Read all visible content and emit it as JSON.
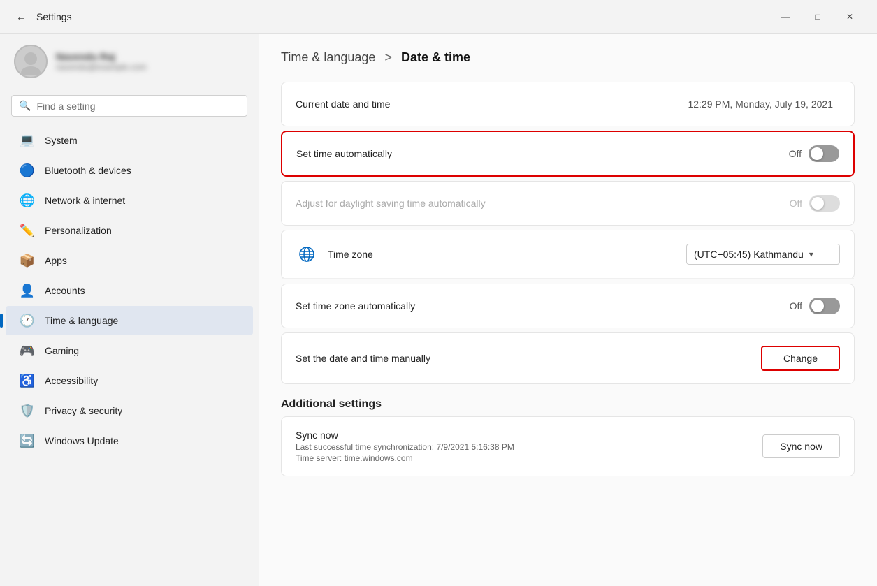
{
  "titlebar": {
    "title": "Settings",
    "back_icon": "←",
    "minimize_icon": "—",
    "maximize_icon": "□",
    "close_icon": "✕"
  },
  "user": {
    "name": "Navendu Raj",
    "email": "navendu@example.com"
  },
  "search": {
    "placeholder": "Find a setting"
  },
  "nav": {
    "items": [
      {
        "id": "system",
        "label": "System",
        "icon": "💻",
        "active": false
      },
      {
        "id": "bluetooth",
        "label": "Bluetooth & devices",
        "icon": "🔵",
        "active": false
      },
      {
        "id": "network",
        "label": "Network & internet",
        "icon": "🌐",
        "active": false
      },
      {
        "id": "personalization",
        "label": "Personalization",
        "icon": "✏️",
        "active": false
      },
      {
        "id": "apps",
        "label": "Apps",
        "icon": "📦",
        "active": false
      },
      {
        "id": "accounts",
        "label": "Accounts",
        "icon": "👤",
        "active": false
      },
      {
        "id": "time-language",
        "label": "Time & language",
        "icon": "🕐",
        "active": true
      },
      {
        "id": "gaming",
        "label": "Gaming",
        "icon": "🎮",
        "active": false
      },
      {
        "id": "accessibility",
        "label": "Accessibility",
        "icon": "♿",
        "active": false
      },
      {
        "id": "privacy-security",
        "label": "Privacy & security",
        "icon": "🛡️",
        "active": false
      },
      {
        "id": "windows-update",
        "label": "Windows Update",
        "icon": "🔄",
        "active": false
      }
    ]
  },
  "page": {
    "breadcrumb_parent": "Time & language",
    "breadcrumb_sep": ">",
    "breadcrumb_current": "Date & time"
  },
  "settings": {
    "current_datetime_label": "Current date and time",
    "current_datetime_value": "12:29 PM, Monday, July 19, 2021",
    "set_time_auto_label": "Set time automatically",
    "set_time_auto_value": "Off",
    "set_time_auto_state": "off",
    "adjust_daylight_label": "Adjust for daylight saving time automatically",
    "adjust_daylight_value": "Off",
    "adjust_daylight_state": "disabled",
    "time_zone_label": "Time zone",
    "time_zone_value": "(UTC+05:45) Kathmandu",
    "set_timezone_auto_label": "Set time zone automatically",
    "set_timezone_auto_value": "Off",
    "set_timezone_auto_state": "off",
    "set_manually_label": "Set the date and time manually",
    "change_btn_label": "Change",
    "additional_settings_title": "Additional settings",
    "sync_title": "Sync now",
    "sync_subtitle_line1": "Last successful time synchronization: 7/9/2021 5:16:38 PM",
    "sync_subtitle_line2": "Time server: time.windows.com",
    "sync_btn_label": "Sync now"
  }
}
